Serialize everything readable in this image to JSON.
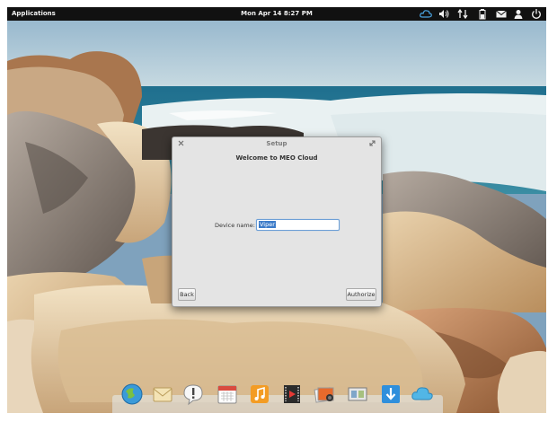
{
  "panel": {
    "applications_label": "Applications",
    "clock": "Mon Apr 14  8:27 PM",
    "indicators": [
      "cloud-icon",
      "volume-icon",
      "network-icon",
      "battery-icon",
      "mail-icon",
      "user-icon",
      "power-icon"
    ]
  },
  "dialog": {
    "title": "Setup",
    "heading": "Welcome to MEO Cloud",
    "device_label": "Device name:",
    "device_value": "Viper",
    "back_label": "Back",
    "authorize_label": "Authorize"
  },
  "dock": {
    "items": [
      "browser-icon",
      "mail-app-icon",
      "notification-icon",
      "calendar-icon",
      "music-icon",
      "video-icon",
      "photos-icon",
      "multitasking-icon",
      "software-center-icon",
      "cloud-app-icon"
    ]
  }
}
